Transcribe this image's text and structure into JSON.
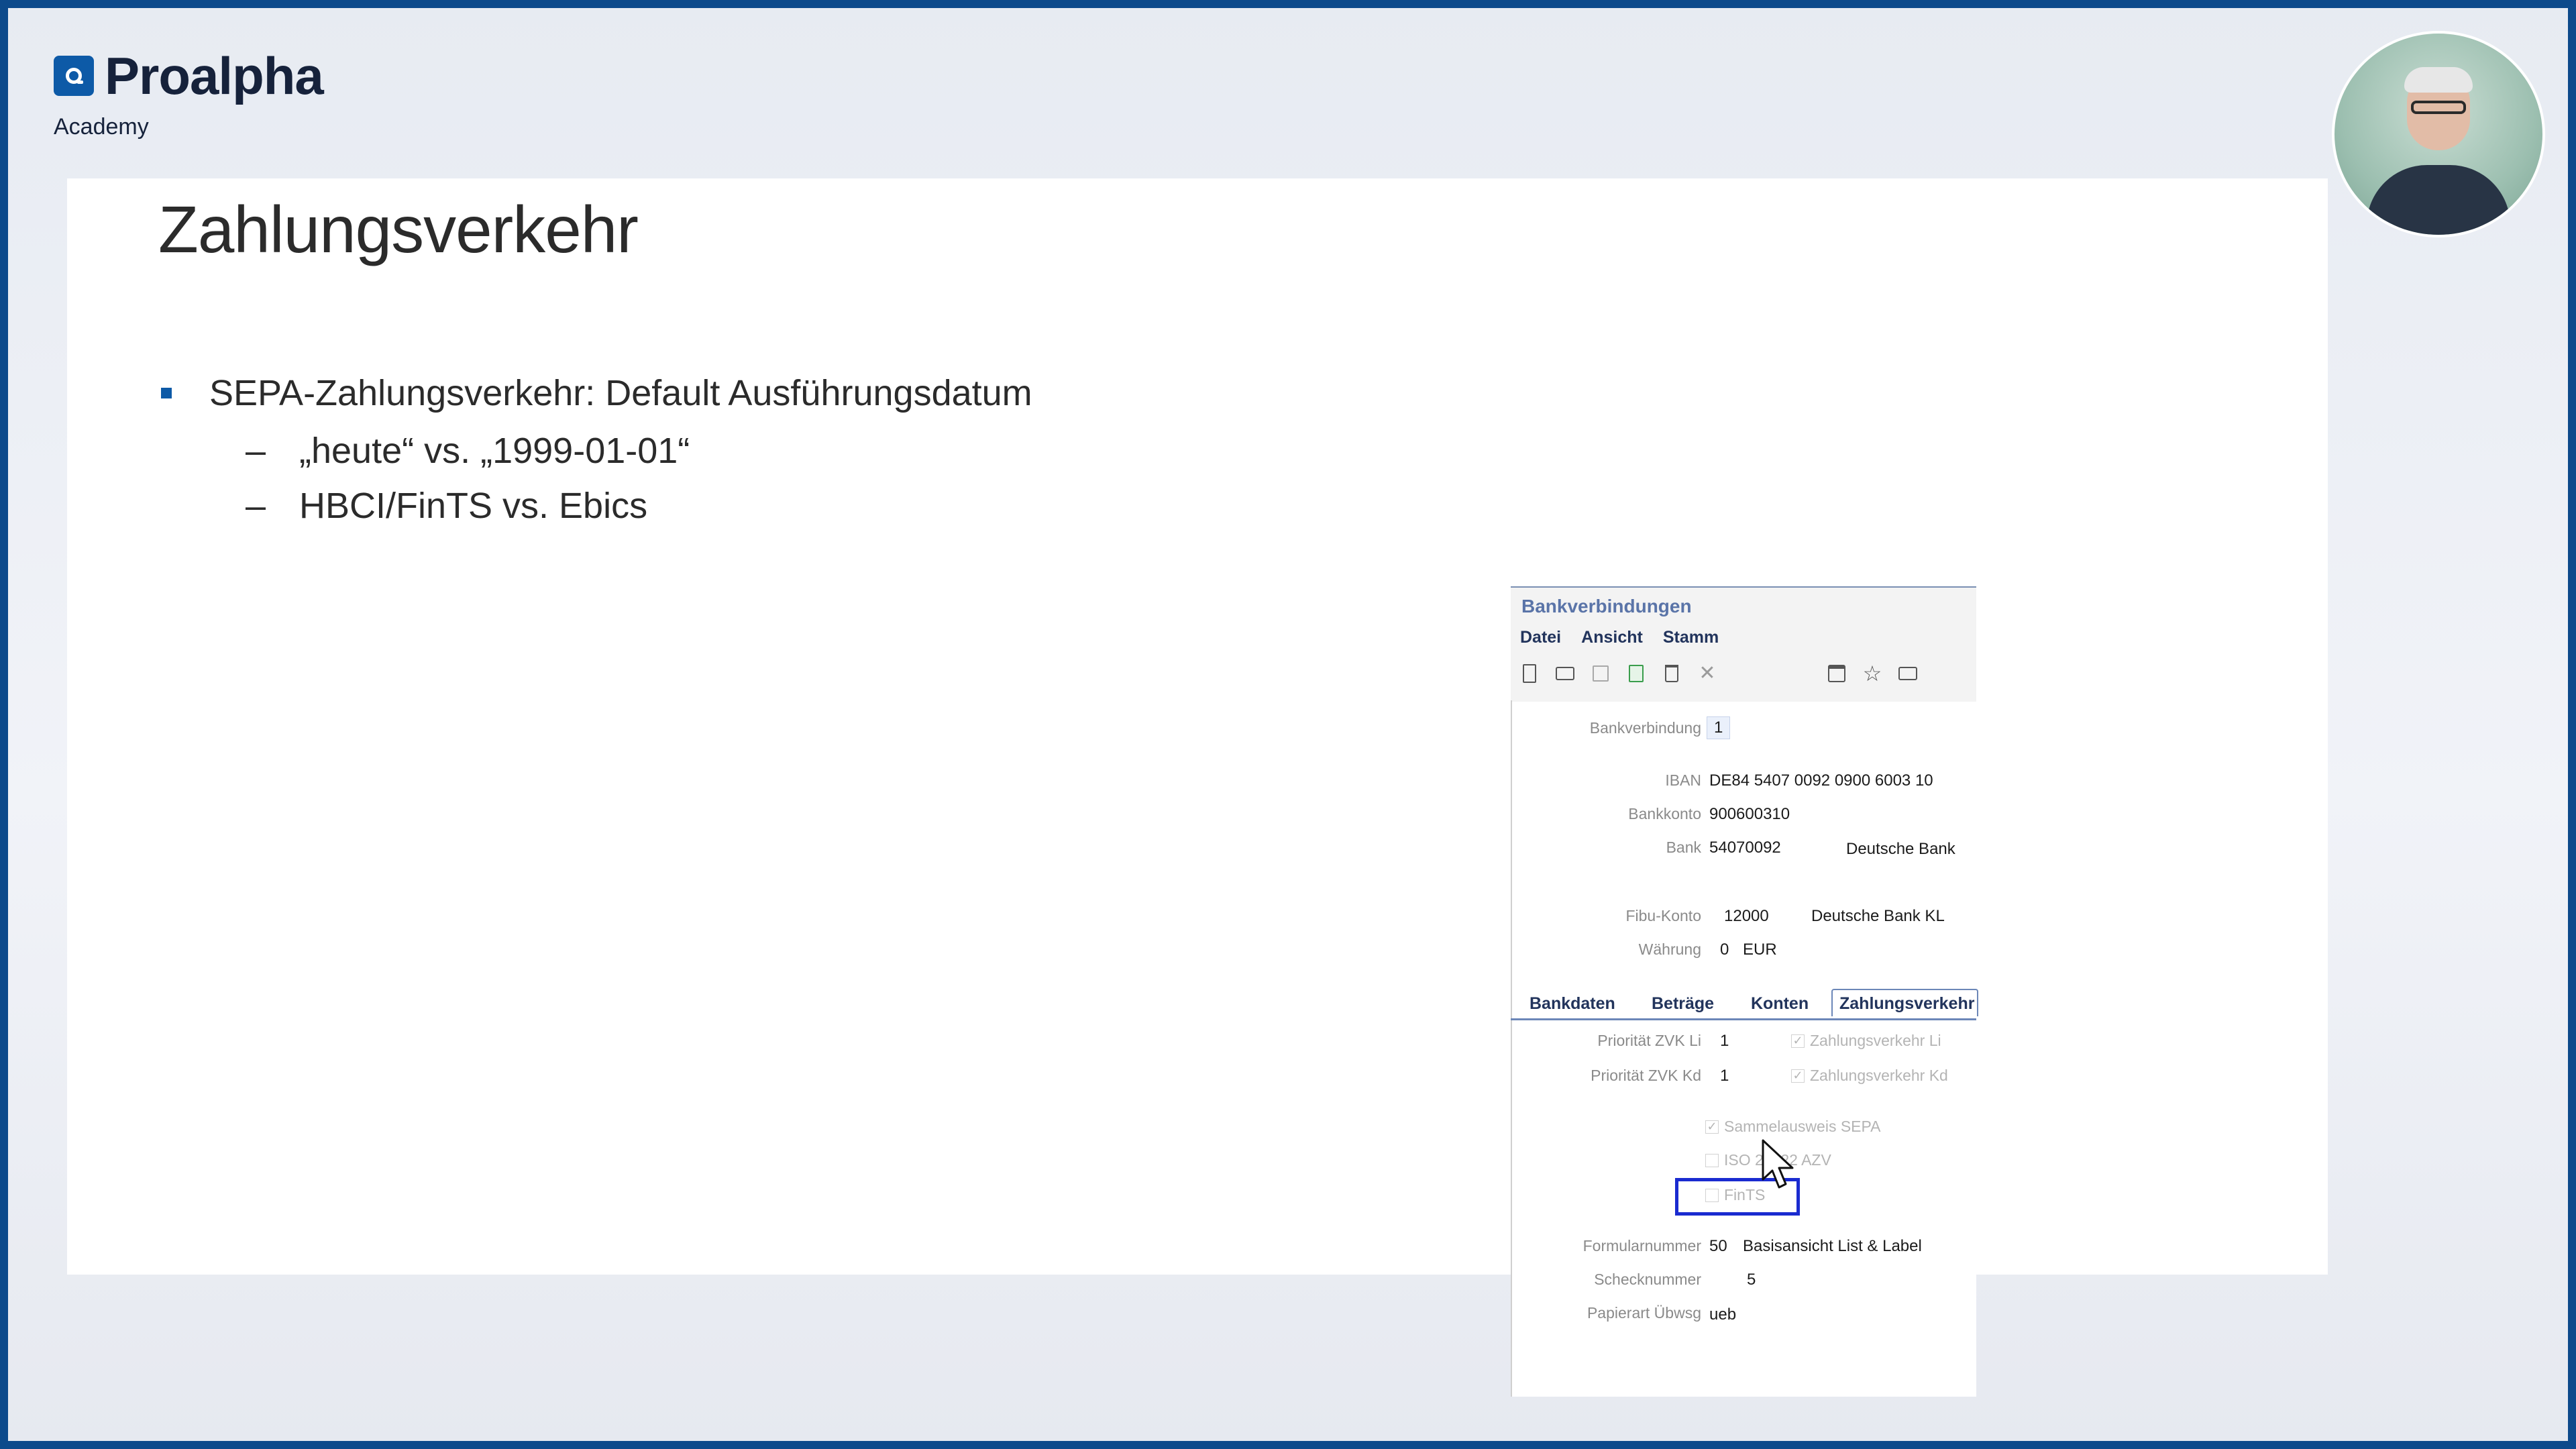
{
  "brand": {
    "name": "Proalpha",
    "subtitle": "Academy"
  },
  "slide": {
    "title": "Zahlungsverkehr",
    "bullet": "SEPA-Zahlungsverkehr: Default Ausführungsdatum",
    "dash_symbol": "–",
    "subbullets": [
      "„heute“ vs. „1999-01-01“",
      "HBCI/FinTS vs. Ebics"
    ]
  },
  "app": {
    "title": "Bankverbindungen",
    "menu": [
      "Datei",
      "Ansicht",
      "Stamm"
    ],
    "toolbar_icons": [
      "new-doc-icon",
      "open-folder-icon",
      "save-icon",
      "copy-icon",
      "delete-icon",
      "close-icon",
      "calendar-icon",
      "star-icon",
      "print-icon"
    ],
    "labels": {
      "bankverbindung": "Bankverbindung",
      "iban": "IBAN",
      "bankkonto": "Bankkonto",
      "bank": "Bank",
      "fibu": "Fibu-Konto",
      "waehrung": "Währung",
      "prio_li": "Priorität ZVK Li",
      "prio_kd": "Priorität ZVK Kd",
      "formular": "Formularnummer",
      "scheck": "Schecknummer",
      "papier": "Papierart Übwsg"
    },
    "values": {
      "bankverbindung": "1",
      "iban": "DE84 5407 0092 0900 6003 10",
      "bankkonto": "900600310",
      "bank_code": "54070092",
      "bank_name": "Deutsche Bank",
      "fibu_code": "12000",
      "fibu_name": "Deutsche Bank KL",
      "waehrung_code": "0",
      "waehrung_name": "EUR",
      "prio_li": "1",
      "prio_kd": "1",
      "formular_code": "50",
      "formular_name": "Basisansicht List & Label",
      "scheck": "5",
      "papier": "ueb"
    },
    "tabs": [
      "Bankdaten",
      "Beträge",
      "Konten",
      "Zahlungsverkehr"
    ],
    "checkboxes": {
      "zvk_li": "Zahlungsverkehr Li",
      "zvk_kd": "Zahlungsverkehr Kd",
      "sepa": "Sammelausweis SEPA",
      "iso": "ISO 20022 AZV",
      "fints": "FinTS"
    },
    "checkmark": "✓"
  },
  "colors": {
    "brand_blue": "#0d5aa7",
    "frame": "#0d4a8b",
    "highlight": "#1a2bd0"
  }
}
